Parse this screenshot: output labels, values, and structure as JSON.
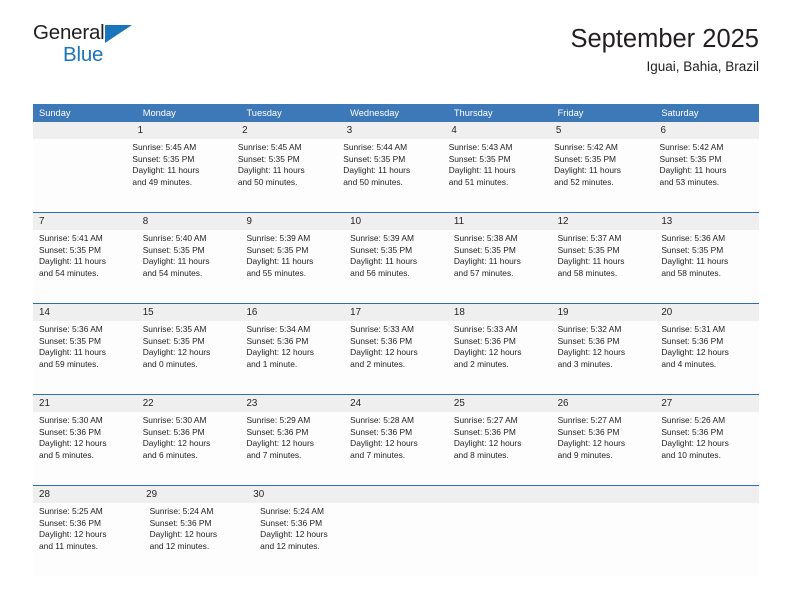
{
  "brand": {
    "name_top": "General",
    "name_bottom": "Blue",
    "accent_color": "#1b75bb"
  },
  "header": {
    "title": "September 2025",
    "subtitle": "Iguai, Bahia, Brazil"
  },
  "calendar": {
    "header_bg": "#3d78b8",
    "row_divider_color": "#2f6fb0",
    "daynum_band_color": "#efefef",
    "weekday_headers": [
      "Sunday",
      "Monday",
      "Tuesday",
      "Wednesday",
      "Thursday",
      "Friday",
      "Saturday"
    ],
    "weeks": [
      {
        "days": [
          {
            "date": "",
            "lines": []
          },
          {
            "date": "1",
            "lines": [
              "Sunrise: 5:45 AM",
              "Sunset: 5:35 PM",
              "Daylight: 11 hours",
              "and 49 minutes."
            ]
          },
          {
            "date": "2",
            "lines": [
              "Sunrise: 5:45 AM",
              "Sunset: 5:35 PM",
              "Daylight: 11 hours",
              "and 50 minutes."
            ]
          },
          {
            "date": "3",
            "lines": [
              "Sunrise: 5:44 AM",
              "Sunset: 5:35 PM",
              "Daylight: 11 hours",
              "and 50 minutes."
            ]
          },
          {
            "date": "4",
            "lines": [
              "Sunrise: 5:43 AM",
              "Sunset: 5:35 PM",
              "Daylight: 11 hours",
              "and 51 minutes."
            ]
          },
          {
            "date": "5",
            "lines": [
              "Sunrise: 5:42 AM",
              "Sunset: 5:35 PM",
              "Daylight: 11 hours",
              "and 52 minutes."
            ]
          },
          {
            "date": "6",
            "lines": [
              "Sunrise: 5:42 AM",
              "Sunset: 5:35 PM",
              "Daylight: 11 hours",
              "and 53 minutes."
            ]
          }
        ]
      },
      {
        "days": [
          {
            "date": "7",
            "lines": [
              "Sunrise: 5:41 AM",
              "Sunset: 5:35 PM",
              "Daylight: 11 hours",
              "and 54 minutes."
            ]
          },
          {
            "date": "8",
            "lines": [
              "Sunrise: 5:40 AM",
              "Sunset: 5:35 PM",
              "Daylight: 11 hours",
              "and 54 minutes."
            ]
          },
          {
            "date": "9",
            "lines": [
              "Sunrise: 5:39 AM",
              "Sunset: 5:35 PM",
              "Daylight: 11 hours",
              "and 55 minutes."
            ]
          },
          {
            "date": "10",
            "lines": [
              "Sunrise: 5:39 AM",
              "Sunset: 5:35 PM",
              "Daylight: 11 hours",
              "and 56 minutes."
            ]
          },
          {
            "date": "11",
            "lines": [
              "Sunrise: 5:38 AM",
              "Sunset: 5:35 PM",
              "Daylight: 11 hours",
              "and 57 minutes."
            ]
          },
          {
            "date": "12",
            "lines": [
              "Sunrise: 5:37 AM",
              "Sunset: 5:35 PM",
              "Daylight: 11 hours",
              "and 58 minutes."
            ]
          },
          {
            "date": "13",
            "lines": [
              "Sunrise: 5:36 AM",
              "Sunset: 5:35 PM",
              "Daylight: 11 hours",
              "and 58 minutes."
            ]
          }
        ]
      },
      {
        "days": [
          {
            "date": "14",
            "lines": [
              "Sunrise: 5:36 AM",
              "Sunset: 5:35 PM",
              "Daylight: 11 hours",
              "and 59 minutes."
            ]
          },
          {
            "date": "15",
            "lines": [
              "Sunrise: 5:35 AM",
              "Sunset: 5:35 PM",
              "Daylight: 12 hours",
              "and 0 minutes."
            ]
          },
          {
            "date": "16",
            "lines": [
              "Sunrise: 5:34 AM",
              "Sunset: 5:36 PM",
              "Daylight: 12 hours",
              "and 1 minute."
            ]
          },
          {
            "date": "17",
            "lines": [
              "Sunrise: 5:33 AM",
              "Sunset: 5:36 PM",
              "Daylight: 12 hours",
              "and 2 minutes."
            ]
          },
          {
            "date": "18",
            "lines": [
              "Sunrise: 5:33 AM",
              "Sunset: 5:36 PM",
              "Daylight: 12 hours",
              "and 2 minutes."
            ]
          },
          {
            "date": "19",
            "lines": [
              "Sunrise: 5:32 AM",
              "Sunset: 5:36 PM",
              "Daylight: 12 hours",
              "and 3 minutes."
            ]
          },
          {
            "date": "20",
            "lines": [
              "Sunrise: 5:31 AM",
              "Sunset: 5:36 PM",
              "Daylight: 12 hours",
              "and 4 minutes."
            ]
          }
        ]
      },
      {
        "days": [
          {
            "date": "21",
            "lines": [
              "Sunrise: 5:30 AM",
              "Sunset: 5:36 PM",
              "Daylight: 12 hours",
              "and 5 minutes."
            ]
          },
          {
            "date": "22",
            "lines": [
              "Sunrise: 5:30 AM",
              "Sunset: 5:36 PM",
              "Daylight: 12 hours",
              "and 6 minutes."
            ]
          },
          {
            "date": "23",
            "lines": [
              "Sunrise: 5:29 AM",
              "Sunset: 5:36 PM",
              "Daylight: 12 hours",
              "and 7 minutes."
            ]
          },
          {
            "date": "24",
            "lines": [
              "Sunrise: 5:28 AM",
              "Sunset: 5:36 PM",
              "Daylight: 12 hours",
              "and 7 minutes."
            ]
          },
          {
            "date": "25",
            "lines": [
              "Sunrise: 5:27 AM",
              "Sunset: 5:36 PM",
              "Daylight: 12 hours",
              "and 8 minutes."
            ]
          },
          {
            "date": "26",
            "lines": [
              "Sunrise: 5:27 AM",
              "Sunset: 5:36 PM",
              "Daylight: 12 hours",
              "and 9 minutes."
            ]
          },
          {
            "date": "27",
            "lines": [
              "Sunrise: 5:26 AM",
              "Sunset: 5:36 PM",
              "Daylight: 12 hours",
              "and 10 minutes."
            ]
          }
        ]
      },
      {
        "days": [
          {
            "date": "28",
            "lines": [
              "Sunrise: 5:25 AM",
              "Sunset: 5:36 PM",
              "Daylight: 12 hours",
              "and 11 minutes."
            ]
          },
          {
            "date": "29",
            "lines": [
              "Sunrise: 5:24 AM",
              "Sunset: 5:36 PM",
              "Daylight: 12 hours",
              "and 12 minutes."
            ]
          },
          {
            "date": "30",
            "lines": [
              "Sunrise: 5:24 AM",
              "Sunset: 5:36 PM",
              "Daylight: 12 hours",
              "and 12 minutes."
            ]
          },
          {
            "date": "",
            "lines": []
          },
          {
            "date": "",
            "lines": []
          },
          {
            "date": "",
            "lines": []
          },
          {
            "date": "",
            "lines": []
          }
        ]
      }
    ]
  }
}
